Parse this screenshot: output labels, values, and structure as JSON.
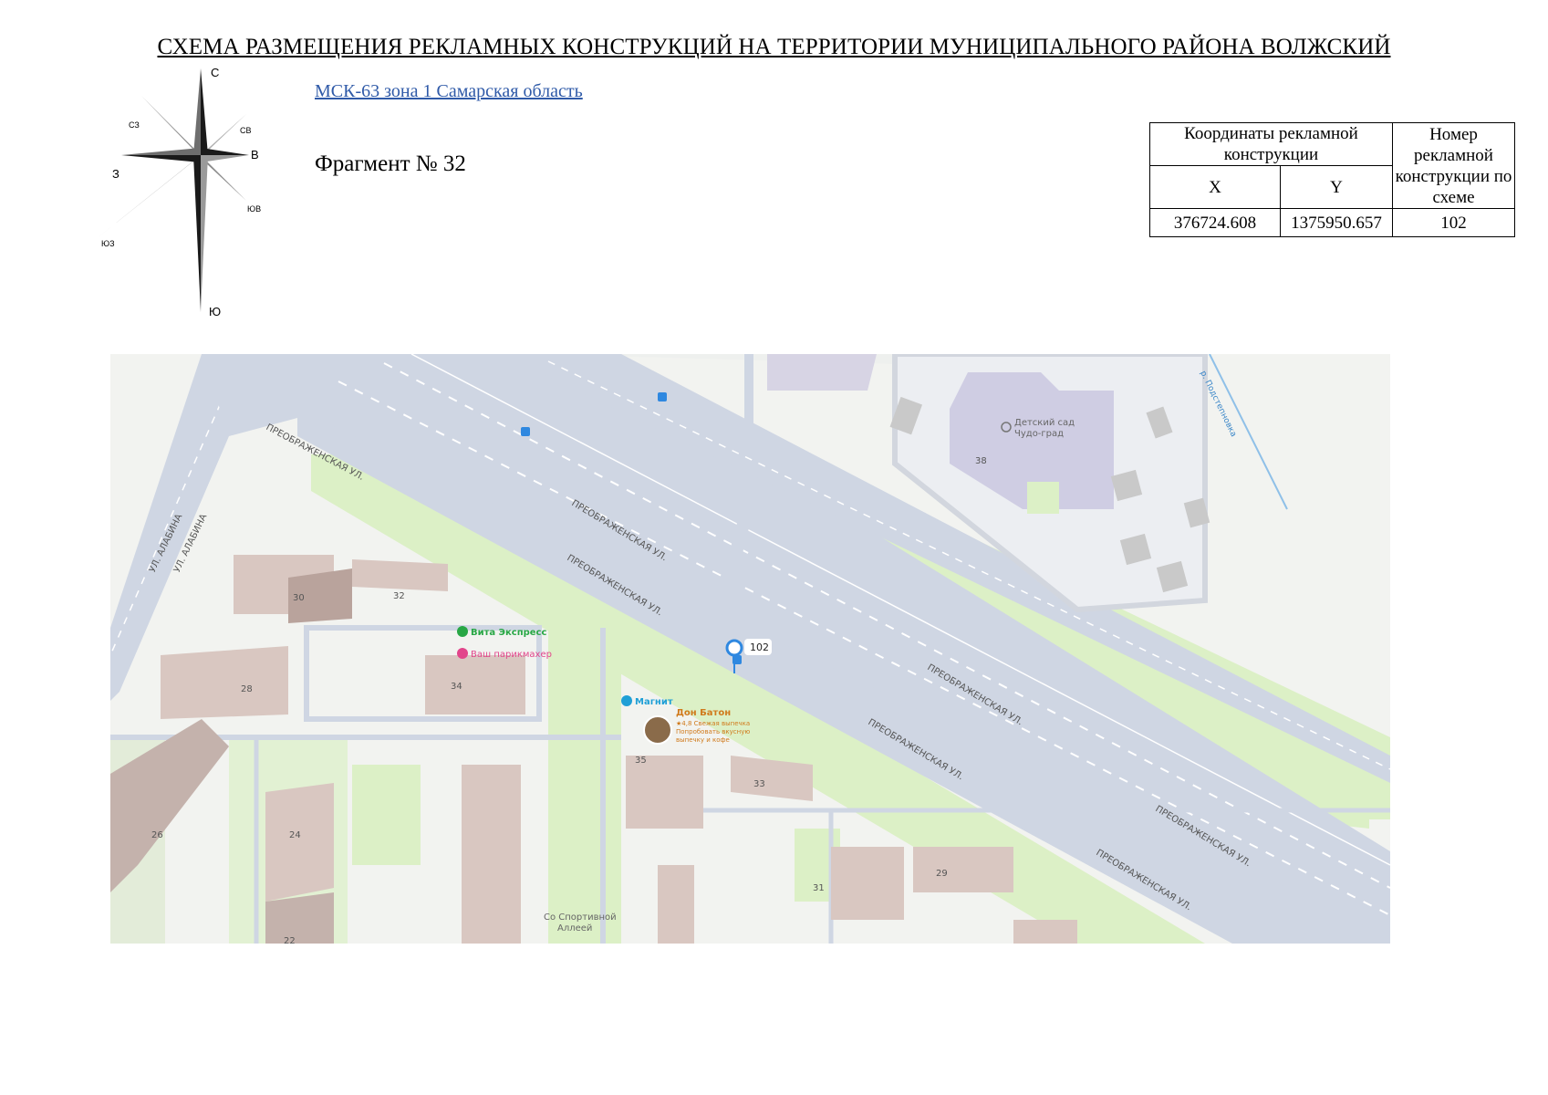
{
  "header": {
    "title": "СХЕМА РАЗМЕЩЕНИЯ РЕКЛАМНЫХ КОНСТРУКЦИЙ НА ТЕРРИТОРИИ МУНИЦИПАЛЬНОГО РАЙОНА ВОЛЖСКИЙ",
    "crs_link": "МСК-63 зона 1 Самарская область",
    "fragment": "Фрагмент № 32"
  },
  "compass": {
    "north": "С",
    "south": "Ю",
    "east": "В",
    "west": "З",
    "ne": "СВ",
    "nw": "СЗ",
    "se": "ЮВ",
    "sw": "ЮЗ"
  },
  "coords_table": {
    "header_coords": "Координаты рекламной конструкции",
    "header_number": "Номер рекламной конструкции по схеме",
    "col_x": "X",
    "col_y": "Y",
    "row": {
      "x": "376724.608",
      "y": "1375950.657",
      "number": "102"
    }
  },
  "map": {
    "street_preobrazhenskaya": "ПРЕОБРАЖЕНСКАЯ УЛ.",
    "street_alabina": "УЛ. АЛАБИНА",
    "river": "р. Подстепновка",
    "kindergarten_line1": "Детский сад",
    "kindergarten_line2": "Чудо-град",
    "marker_label": "102",
    "poi_vita": "Вита Экспресс",
    "poi_hairdresser": "Ваш парикмахер",
    "poi_magnit": "Магнит",
    "poi_don_baton": "Дон Батон",
    "poi_don_baton_rating": "★4,8 Свежая выпечка",
    "poi_don_baton_line2": "Попробовать вкусную",
    "poi_don_baton_line3": "выпечку и кофе",
    "alley_line1": "Со Спортивной",
    "alley_line2": "Аллеей",
    "buildings": {
      "b38": "38",
      "b30": "30",
      "b32": "32",
      "b28": "28",
      "b34": "34",
      "b35": "35",
      "b33": "33",
      "b26": "26",
      "b24": "24",
      "b22": "22",
      "b31": "31",
      "b29": "29"
    },
    "colors": {
      "road": "#cfd6e3",
      "green": "#dcf0c6",
      "ground": "#f2f3f0",
      "building": "#d9c7c1",
      "marker": "#2f88e0",
      "poi_green": "#28a745",
      "poi_pink": "#e2458b",
      "poi_blue": "#1f9fd6",
      "poi_orange": "#d07a1c"
    }
  }
}
